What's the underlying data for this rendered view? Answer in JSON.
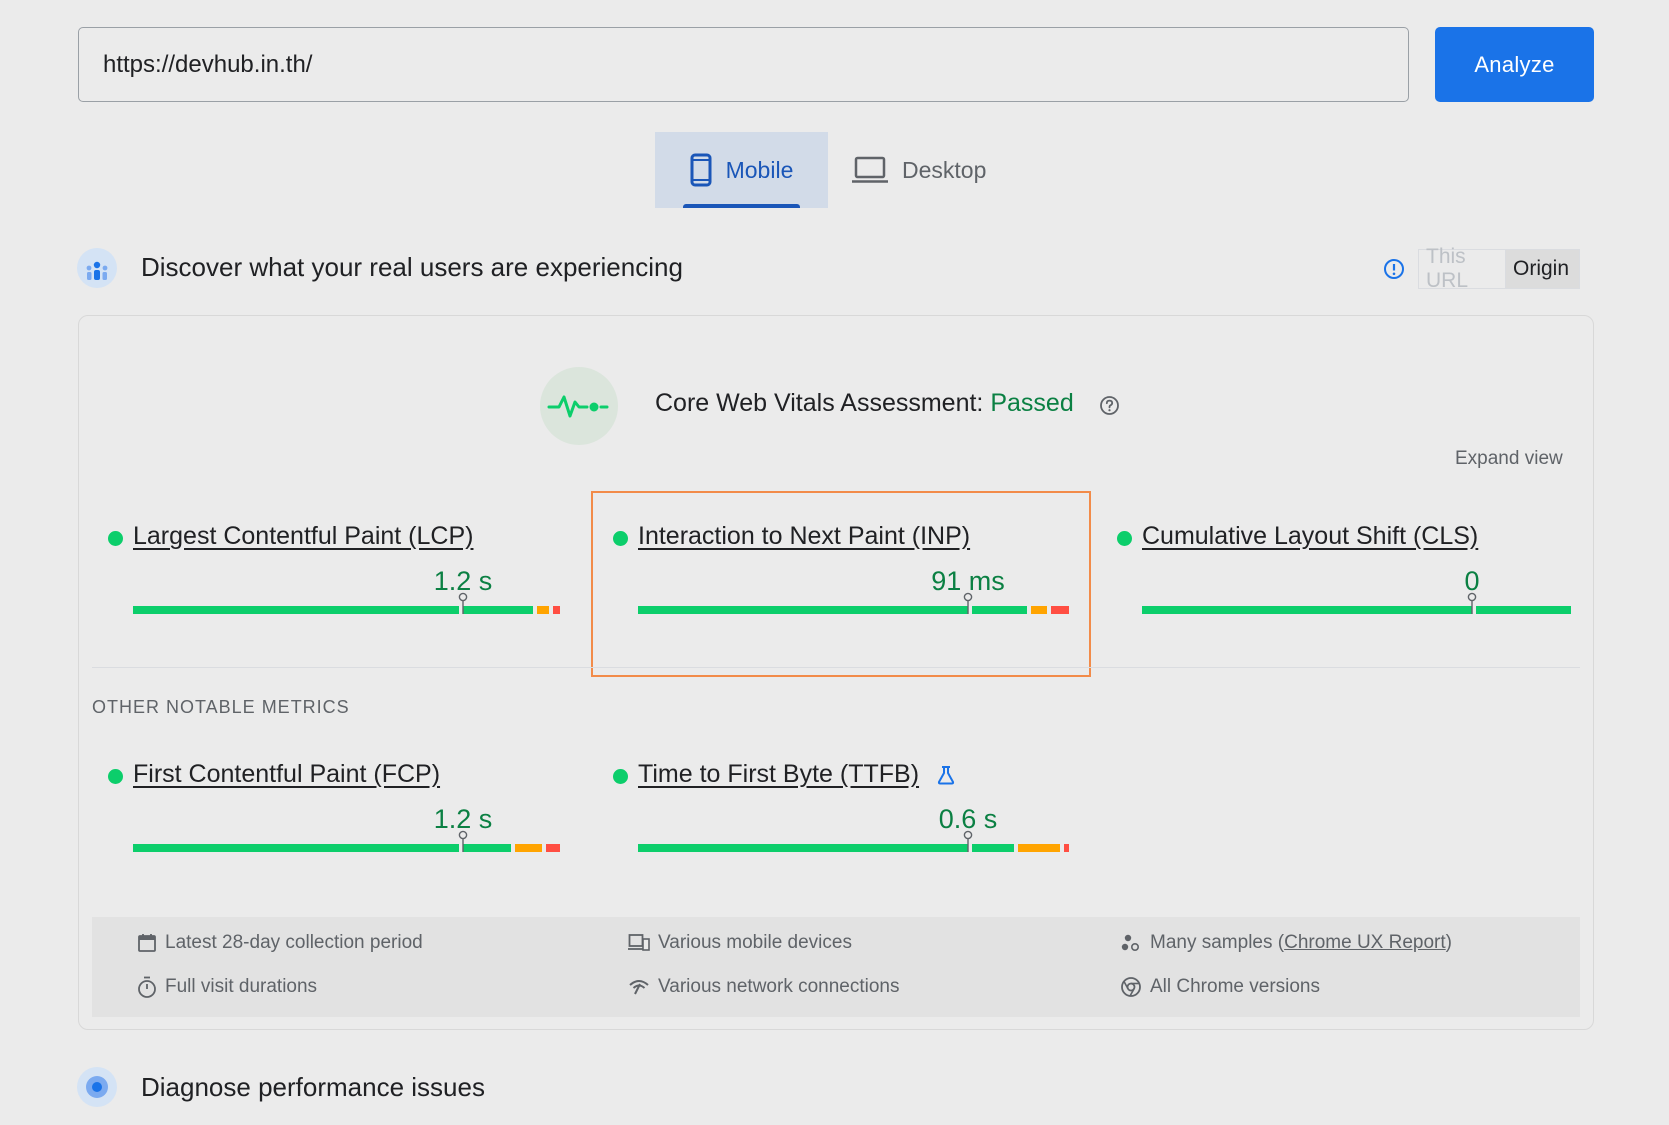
{
  "search": {
    "url_value": "https://devhub.in.th/",
    "analyze_label": "Analyze"
  },
  "device_tabs": {
    "mobile_label": "Mobile",
    "desktop_label": "Desktop",
    "selected": "Mobile"
  },
  "field_section": {
    "title": "Discover what your real users are experiencing",
    "toggle": {
      "this_url": "This URL",
      "origin": "Origin",
      "selected": "Origin"
    }
  },
  "assessment": {
    "label": "Core Web Vitals Assessment:",
    "status": "Passed",
    "expand_label": "Expand view"
  },
  "core_metrics": [
    {
      "name": "Largest Contentful Paint (LCP)",
      "value": "1.2 s",
      "marker": 0.75,
      "dist": [
        0.74,
        0.17,
        0.035,
        0.025
      ]
    },
    {
      "name": "Interaction to Next Paint (INP)",
      "value": "91 ms",
      "marker": 0.75,
      "dist": [
        0.75,
        0.135,
        0.045,
        0.05
      ]
    },
    {
      "name": "Cumulative Layout Shift (CLS)",
      "value": "0",
      "marker": 0.75,
      "dist": [
        0.75,
        0.225,
        0.0,
        0.005
      ]
    }
  ],
  "other_title": "OTHER NOTABLE METRICS",
  "other_metrics": [
    {
      "name": "First Contentful Paint (FCP)",
      "value": "1.2 s",
      "marker": 0.75,
      "dist": [
        0.74,
        0.12,
        0.07,
        0.04
      ]
    },
    {
      "name": "Time to First Byte (TTFB)",
      "value": "0.6 s",
      "marker": 0.75,
      "dist": [
        0.75,
        0.105,
        0.105,
        0.02
      ],
      "experimental": true
    }
  ],
  "footer": {
    "collection_period": "Latest 28-day collection period",
    "devices": "Various mobile devices",
    "samples_prefix": "Many samples (",
    "samples_link": "Chrome UX Report",
    "samples_suffix": ")",
    "visit_durations": "Full visit durations",
    "network": "Various network connections",
    "chrome_versions": "All Chrome versions"
  },
  "diagnose_section": {
    "title": "Diagnose performance issues"
  },
  "colors": {
    "good": "#0cce6b",
    "ni": "#ffa400",
    "poor": "#ff4e42",
    "accent": "#1a73e8",
    "pass": "#0b8043"
  }
}
